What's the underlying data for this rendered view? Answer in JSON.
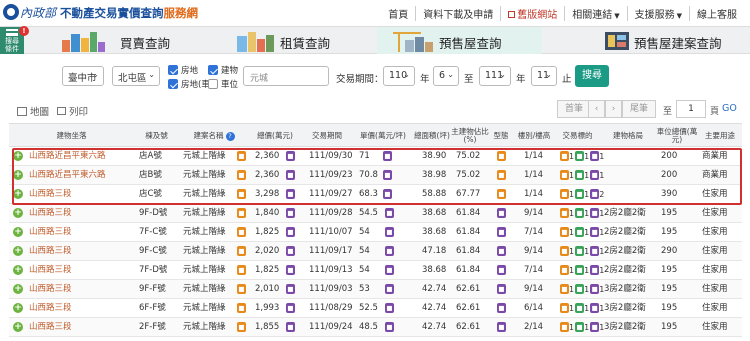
{
  "header": {
    "brand": "內政部",
    "title_main": "不動產交易實價查詢",
    "title_accent": "服務網",
    "nav": [
      "首頁",
      "資料下載及申請",
      "舊版網站",
      "相關連結",
      "支援服務",
      "線上客服"
    ]
  },
  "condition_button": {
    "label": "搜尋條件",
    "alert": "!"
  },
  "tabs": [
    "買賣查詢",
    "租賃查詢",
    "預售屋查詢",
    "預售屋建案查詢"
  ],
  "filters": {
    "city": "臺中市",
    "district": "北屯區",
    "checkboxes": [
      {
        "label": "房地",
        "checked": true
      },
      {
        "label": "建物",
        "checked": true
      },
      {
        "label": "房地(車)",
        "checked": true
      },
      {
        "label": "車位",
        "checked": false
      }
    ],
    "community_placeholder": "元城",
    "period_label": "交易期間：",
    "from_year": "110",
    "from_month": "6",
    "to_year": "111",
    "to_month": "11",
    "year_label": "年",
    "to_label": "至",
    "end_label": "止",
    "search_label": "搜尋"
  },
  "toolbar": {
    "map": "地圖",
    "print": "列印",
    "first": "首筆",
    "prev": "‹",
    "next": "›",
    "last": "尾筆",
    "to_label": "至",
    "page": "1",
    "page_label": "頁",
    "go": "GO"
  },
  "table": {
    "headers": [
      "建物坐落",
      "棟及號",
      "建案名稱",
      "總價(萬元)",
      "交易期間",
      "單價(萬元/坪)",
      "總面積(坪)",
      "主建物佔比(%)",
      "型態",
      "樓別/樓高",
      "交易標的",
      "建物格局",
      "車位總價(萬元)",
      "主要用途"
    ],
    "rows": [
      {
        "address": "山西路近昌平東六路",
        "unit": "店A號",
        "project": "元城上階綠",
        "price": "2,360",
        "date": "111/09/30",
        "unit_price": "71",
        "area": "38.90",
        "main_ratio": "75.02",
        "floor": "1/14",
        "layout": "",
        "parking": "200",
        "usage": "商業用",
        "target": [
          {
            "c": "orange",
            "n": "1"
          },
          {
            "c": "green",
            "n": "1"
          },
          {
            "c": "purple",
            "n": "1"
          }
        ]
      },
      {
        "address": "山西路近昌平東六路",
        "unit": "店B號",
        "project": "元城上階綠",
        "price": "2,360",
        "date": "111/09/23",
        "unit_price": "70.8",
        "area": "38.98",
        "main_ratio": "75.02",
        "floor": "1/14",
        "layout": "",
        "parking": "200",
        "usage": "商業用",
        "target": [
          {
            "c": "orange",
            "n": "1"
          },
          {
            "c": "green",
            "n": "1"
          },
          {
            "c": "purple",
            "n": "1"
          }
        ]
      },
      {
        "address": "山西路三段",
        "unit": "店C號",
        "project": "元城上階綠",
        "price": "3,298",
        "date": "111/09/27",
        "unit_price": "68.3",
        "area": "58.88",
        "main_ratio": "67.77",
        "floor": "1/14",
        "layout": "",
        "parking": "390",
        "usage": "住家用",
        "target": [
          {
            "c": "orange",
            "n": "1"
          },
          {
            "c": "green",
            "n": "1"
          },
          {
            "c": "purple",
            "n": "2"
          }
        ]
      },
      {
        "address": "山西路三段",
        "unit": "9F-D號",
        "project": "元城上階綠",
        "price": "1,840",
        "date": "111/09/28",
        "unit_price": "54.5",
        "area": "38.68",
        "main_ratio": "61.84",
        "floor": "9/14",
        "layout": "2房2廳2衛",
        "parking": "195",
        "usage": "住家用",
        "target": [
          {
            "c": "orange",
            "n": "1"
          },
          {
            "c": "green",
            "n": "1"
          },
          {
            "c": "purple",
            "n": "1"
          }
        ]
      },
      {
        "address": "山西路三段",
        "unit": "7F-C號",
        "project": "元城上階綠",
        "price": "1,825",
        "date": "111/10/07",
        "unit_price": "54",
        "area": "38.68",
        "main_ratio": "61.84",
        "floor": "7/14",
        "layout": "2房2廳2衛",
        "parking": "195",
        "usage": "住家用",
        "target": [
          {
            "c": "orange",
            "n": "1"
          },
          {
            "c": "green",
            "n": "1"
          },
          {
            "c": "purple",
            "n": "1"
          }
        ]
      },
      {
        "address": "山西路三段",
        "unit": "9F-C號",
        "project": "元城上階綠",
        "price": "2,020",
        "date": "111/09/17",
        "unit_price": "54",
        "area": "47.18",
        "main_ratio": "61.84",
        "floor": "9/14",
        "layout": "2房2廳2衛",
        "parking": "290",
        "usage": "住家用",
        "target": [
          {
            "c": "orange",
            "n": "1"
          },
          {
            "c": "green",
            "n": "1"
          },
          {
            "c": "purple",
            "n": "1"
          }
        ]
      },
      {
        "address": "山西路三段",
        "unit": "7F-D號",
        "project": "元城上階綠",
        "price": "1,825",
        "date": "111/09/13",
        "unit_price": "54",
        "area": "38.68",
        "main_ratio": "61.84",
        "floor": "7/14",
        "layout": "2房2廳2衛",
        "parking": "195",
        "usage": "住家用",
        "target": [
          {
            "c": "orange",
            "n": "1"
          },
          {
            "c": "green",
            "n": "1"
          },
          {
            "c": "purple",
            "n": "1"
          }
        ]
      },
      {
        "address": "山西路三段",
        "unit": "9F-F號",
        "project": "元城上階綠",
        "price": "2,010",
        "date": "111/09/03",
        "unit_price": "53",
        "area": "42.74",
        "main_ratio": "62.61",
        "floor": "9/14",
        "layout": "3房2廳2衛",
        "parking": "195",
        "usage": "住家用",
        "target": [
          {
            "c": "orange",
            "n": "1"
          },
          {
            "c": "green",
            "n": "1"
          },
          {
            "c": "purple",
            "n": "1"
          }
        ]
      },
      {
        "address": "山西路三段",
        "unit": "6F-F號",
        "project": "元城上階綠",
        "price": "1,993",
        "date": "111/08/29",
        "unit_price": "52.5",
        "area": "42.74",
        "main_ratio": "62.61",
        "floor": "6/14",
        "layout": "3房2廳2衛",
        "parking": "195",
        "usage": "住家用",
        "target": [
          {
            "c": "orange",
            "n": "1"
          },
          {
            "c": "green",
            "n": "1"
          },
          {
            "c": "purple",
            "n": "1"
          }
        ]
      },
      {
        "address": "山西路三段",
        "unit": "2F-F號",
        "project": "元城上階綠",
        "price": "1,855",
        "date": "111/09/24",
        "unit_price": "48.5",
        "area": "42.74",
        "main_ratio": "62.61",
        "floor": "2/14",
        "layout": "3房2廳2衛",
        "parking": "195",
        "usage": "住家用",
        "target": [
          {
            "c": "orange",
            "n": "1"
          },
          {
            "c": "green",
            "n": "1"
          },
          {
            "c": "purple",
            "n": "1"
          }
        ]
      }
    ]
  },
  "colors": {
    "brand_blue": "#1a4f9c",
    "accent_orange": "#e06a1a",
    "search_green": "#1b9a86",
    "highlight_red": "#d03030",
    "address_orange": "#c05a2a"
  }
}
